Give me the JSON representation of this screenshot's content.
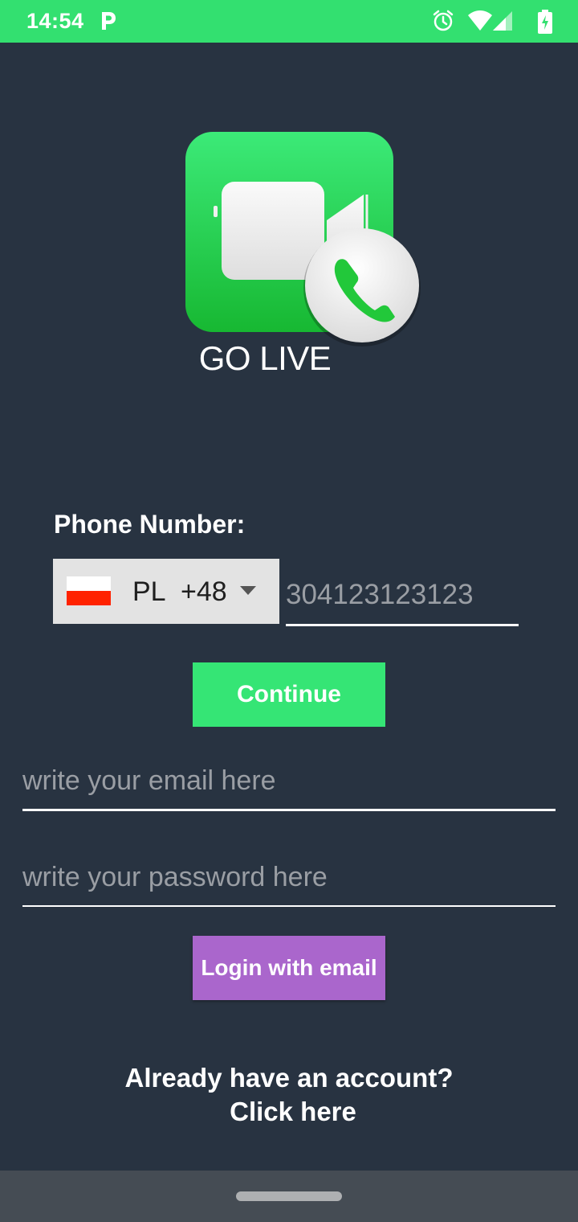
{
  "status_bar": {
    "time": "14:54",
    "icons": [
      "parking-icon",
      "alarm-icon",
      "wifi-icon",
      "signal-icon",
      "battery-charging-icon"
    ],
    "background": "#33e070"
  },
  "logo": {
    "title": "GO LIVE",
    "icon": "video-call-icon"
  },
  "phone": {
    "label": "Phone Number:",
    "country_code": "PL",
    "dial_code": "+48",
    "flag": "poland-flag",
    "placeholder": "304123123123"
  },
  "buttons": {
    "continue": "Continue",
    "login_email": "Login with email"
  },
  "email": {
    "placeholder": "write your email here"
  },
  "password": {
    "placeholder": "write your password here"
  },
  "account": {
    "line1": "Already have an account?",
    "line2": "Click here"
  },
  "colors": {
    "background": "#283341",
    "accent_green": "#35e575",
    "accent_purple": "#aa66cc"
  }
}
